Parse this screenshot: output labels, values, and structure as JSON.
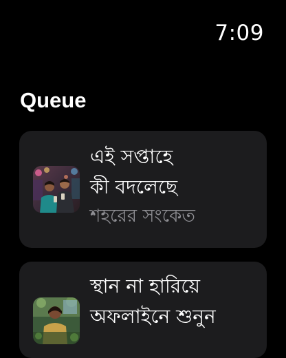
{
  "status_bar": {
    "time": "7:09"
  },
  "screen": {
    "title": "Queue"
  },
  "queue": [
    {
      "title_lines": [
        "এই সপ্তাহে",
        "কী বদলেছে"
      ],
      "subtitle": "শহরের সংকেত",
      "thumbnail_icon": "podcast-artwork-two-people-city-night"
    },
    {
      "title_lines": [
        "স্থান না হারিয়ে",
        "অফলাইনে শুনুন"
      ],
      "subtitle": "",
      "thumbnail_icon": "podcast-artwork-person-outdoors"
    }
  ],
  "colors": {
    "background": "#000000",
    "card": "#1c1c1e",
    "secondary_text": "#8e8e93"
  }
}
